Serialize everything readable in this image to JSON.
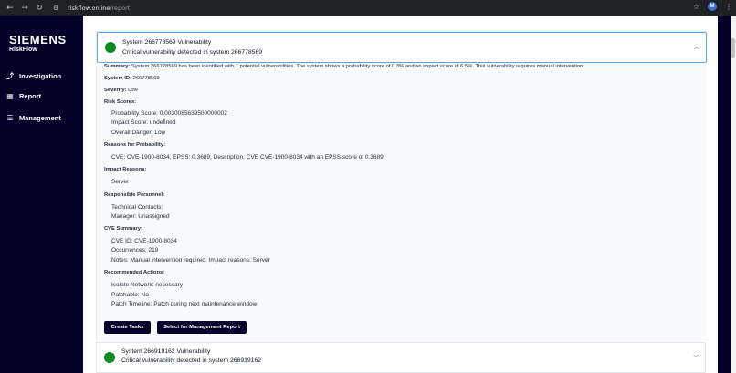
{
  "browser": {
    "url_host": "riskflow.online",
    "url_path": "/report",
    "profile_initial": "M"
  },
  "sidebar": {
    "brand": "SIEMENS",
    "product": "RiskFlow",
    "items": [
      {
        "label": "Investigation",
        "icon": "chart-line-icon"
      },
      {
        "label": "Report",
        "icon": "dashboard-icon"
      },
      {
        "label": "Management",
        "icon": "list-icon"
      }
    ]
  },
  "cards": [
    {
      "title": "System 266778569 Vulnerability",
      "subtitle": "Critical vulnerability detected in system 266778569",
      "status_color": "#0a8a1f",
      "expanded": true,
      "summary_label": "Summary:",
      "summary_text": "System 266778569 has been identified with 1 potential vulnerabilities. The system shows a probability score of 0.3% and an impact score of 6.5%. This vulnerability requires manual intervention.",
      "system_id_label": "System ID:",
      "system_id": "266778569",
      "severity_label": "Severity:",
      "severity": "Low",
      "risk_scores_label": "Risk Scores:",
      "probability_score": "Probability Score: 0.0030085639500000002",
      "impact_score": "Impact Score: undefined",
      "overall_danger": "Overall Danger: Low",
      "reasons_probability_label": "Reasons for Probability:",
      "reasons_probability": "CVE: CVE-1900-8034, EPSS: 0.3689, Description: CVE CVE-1900-8034 with an EPSS score of 0.3689",
      "impact_reasons_label": "Impact Reasons:",
      "impact_reasons": "Server",
      "personnel_label": "Responsible Personnel:",
      "technical_contacts": "Technical Contacts:",
      "manager": "Manager: Unassigned",
      "cve_summary_label": "CVE Summary:",
      "cve_id": "CVE ID: CVE-1900-8034",
      "occurrences": "Occurrences: 219",
      "notes": "Notes: Manual intervention required. Impact reasons: Server",
      "actions_label": "Recommended Actions:",
      "isolate": "Isolate Network: necessary",
      "patchable": "Patchable: No",
      "patch_timeline": "Patch Timeline: Patch during next maintenance window",
      "btn_tasks": "Create Tasks",
      "btn_report": "Select for Management Report"
    },
    {
      "title": "System 266919162 Vulnerability",
      "subtitle": "Critical vulnerability detected in system 266919162",
      "status_color": "#0a8a1f",
      "expanded": false
    }
  ]
}
